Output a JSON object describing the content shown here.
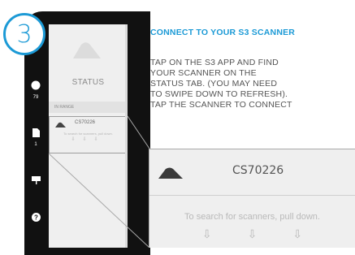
{
  "step": {
    "number": "3"
  },
  "heading": {
    "text": "CONNECT TO YOUR S3 SCANNER"
  },
  "instructions": {
    "lines": [
      "TAP ON THE S3 APP AND FIND",
      "YOUR SCANNER ON THE",
      "STATUS TAB. (YOU MAY NEED",
      "TO SWIPE DOWN TO REFRESH).",
      "TAP THE SCANNER TO CONNECT"
    ]
  },
  "phone": {
    "rail": [
      {
        "icon": "status-circle-icon",
        "count": "79"
      },
      {
        "icon": "document-icon",
        "count": "1"
      },
      {
        "icon": "presentation-icon",
        "count": ""
      },
      {
        "icon": "help-icon",
        "count": ""
      }
    ],
    "screen": {
      "logo_icon": "scanner-logo-icon",
      "title": "STATUS",
      "section": "IN RANGE",
      "scanner": {
        "icon": "scanner-icon",
        "name": "CS70226"
      },
      "pull_hint": "To search for scanners, pull down.",
      "pull_arrows": [
        "⇩",
        "⇩",
        "⇩"
      ]
    }
  },
  "zoom": {
    "scanner_icon": "scanner-icon",
    "scanner_name": "CS70226",
    "pull_hint": "To search for scanners, pull down.",
    "pull_arrows": [
      "⇩",
      "⇩",
      "⇩"
    ]
  },
  "colors": {
    "accent": "#1c9ad6",
    "body_text": "#555555",
    "phone": "#111111",
    "screen": "#efefef"
  }
}
